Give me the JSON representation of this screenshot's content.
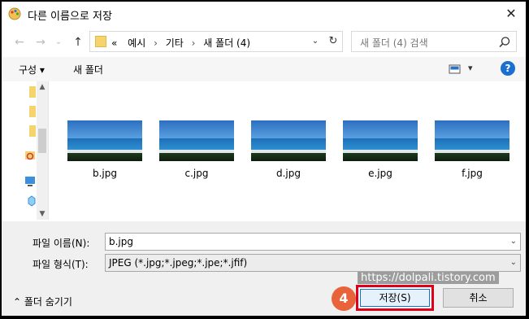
{
  "window": {
    "title": "다른 이름으로 저장",
    "close_glyph": "✕",
    "icon": "paint-app-icon"
  },
  "navigation": {
    "back_glyph": "←",
    "forward_glyph": "→",
    "dropdown_glyph": "⌄",
    "up_glyph": "↑",
    "breadcrumbs": [
      "«",
      "예시",
      "기타",
      "새 폴더 (4)"
    ],
    "separator": "›",
    "address_dropdown_glyph": "⌄",
    "refresh_glyph": "↻",
    "search_placeholder": "새 폴더 (4) 검색"
  },
  "toolbar": {
    "organize_label": "구성 ▾",
    "new_folder_label": "새 폴더",
    "view_dropdown_glyph": "▾",
    "help_label": "?"
  },
  "files": [
    {
      "name": "b.jpg"
    },
    {
      "name": "c.jpg"
    },
    {
      "name": "d.jpg"
    },
    {
      "name": "e.jpg"
    },
    {
      "name": "f.jpg"
    }
  ],
  "form": {
    "filename_label": "파일 이름(N):",
    "filename_value": "b.jpg",
    "filetype_label": "파일 형식(T):",
    "filetype_value": "JPEG (*.jpg;*.jpeg;*.jpe;*.jfif)",
    "dropdown_glyph": "⌄"
  },
  "footer": {
    "hide_folders_label": "⌃ 폴더 숨기기",
    "watermark": "https://dolpali.tistory.com",
    "step_badge": "4",
    "save_label": "저장(S)",
    "cancel_label": "취소"
  },
  "colors": {
    "accent": "#0078d7",
    "highlight_border": "#e0001a",
    "step_badge": "#e8623a"
  }
}
